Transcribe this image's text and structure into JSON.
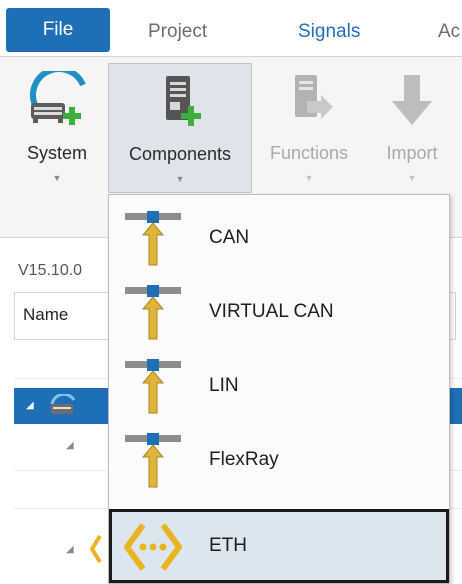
{
  "tabs": {
    "file": "File",
    "project": "Project",
    "signals": "Signals",
    "more": "Ac"
  },
  "ribbon": {
    "system": "System",
    "components": "Components",
    "functions": "Functions",
    "import": "Import"
  },
  "panel": {
    "version": "V15.10.0",
    "name_column": "Name"
  },
  "menu": {
    "items": [
      "CAN",
      "VIRTUAL CAN",
      "LIN",
      "FlexRay",
      "ETH"
    ]
  },
  "colors": {
    "accent": "#1f6fb6",
    "connector_arrow": "#e0b43a",
    "eth_icon": "#e8b520"
  }
}
